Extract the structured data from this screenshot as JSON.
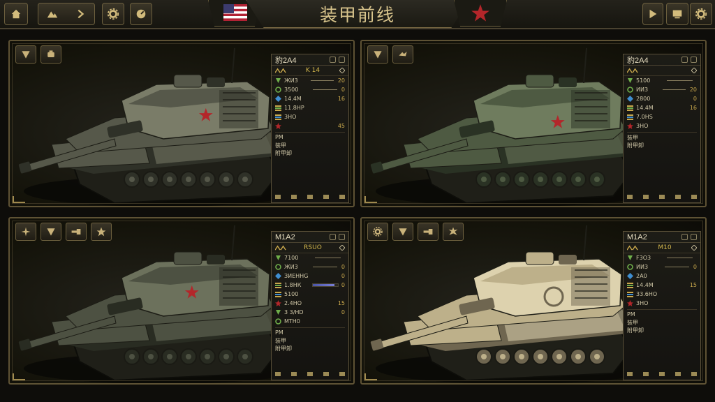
{
  "header": {
    "title": "装甲前线",
    "nations": [
      "us-flag-icon",
      "red-star-icon"
    ],
    "left_buttons": [
      "home-icon",
      "hills-icon",
      "chevron-right-icon",
      "gear-icon",
      "gauge-icon"
    ],
    "right_buttons": [
      "play-icon",
      "monitor-icon",
      "gear-icon"
    ]
  },
  "colors": {
    "accent": "#c9a84c",
    "border": "#5e5234",
    "red_star": "#b3262a",
    "bar": "#5a64c0"
  },
  "panels": [
    {
      "name": "豹2A4",
      "class_label": "K 14",
      "rows": [
        {
          "label": "ЖИ3",
          "value": "20"
        },
        {
          "label": "3500",
          "value": "0"
        },
        {
          "label": "14.4M",
          "value": "16"
        },
        {
          "label": "11.8НР",
          "value": ""
        },
        {
          "label": "3HO",
          "value": ""
        },
        {
          "label": "",
          "value": "45"
        }
      ],
      "foot_labels": [
        "PM",
        "装甲",
        "附甲卸"
      ],
      "tools": [
        "armor-icon",
        "engine-icon"
      ]
    },
    {
      "name": "豹2A4",
      "class_label": "",
      "rows": [
        {
          "label": "5100",
          "value": ""
        },
        {
          "label": "ИИ3",
          "value": "20"
        },
        {
          "label": "2800",
          "value": "0"
        },
        {
          "label": "14.4M",
          "value": "16"
        },
        {
          "label": "7.0HS",
          "value": ""
        },
        {
          "label": "3HO",
          "value": ""
        }
      ],
      "foot_labels": [
        "装甲",
        "附甲卸"
      ],
      "tools": [
        "armor-icon",
        "track-icon"
      ]
    },
    {
      "name": "M1A2",
      "class_label": "RSUO",
      "rows": [
        {
          "label": "7100",
          "value": ""
        },
        {
          "label": "ЖИ3",
          "value": "0"
        },
        {
          "label": "ЗИЕННG",
          "value": "0"
        },
        {
          "label": "1.8НК",
          "value": "0",
          "bar": 0.85
        },
        {
          "label": "5100",
          "value": ""
        },
        {
          "label": "2.4HO",
          "value": "15"
        },
        {
          "label": "3 3/HD",
          "value": "0"
        },
        {
          "label": "MTH0",
          "value": ""
        }
      ],
      "foot_labels": [
        "PM",
        "装甲",
        "附甲卸"
      ],
      "tools": [
        "compass-icon",
        "armor-icon",
        "cannon-icon",
        "star-icon"
      ]
    },
    {
      "name": "M1A2",
      "class_label": "M10",
      "rows": [
        {
          "label": "F3O3",
          "value": ""
        },
        {
          "label": "ИИ3",
          "value": "0"
        },
        {
          "label": "2A0",
          "value": ""
        },
        {
          "label": "14.4M",
          "value": "15"
        },
        {
          "label": "33.6HO",
          "value": ""
        },
        {
          "label": "3HO",
          "value": ""
        }
      ],
      "foot_labels": [
        "PM",
        "装甲",
        "附甲卸"
      ],
      "tools": [
        "gear-icon",
        "armor-icon",
        "cannon-icon",
        "splash-icon"
      ]
    }
  ]
}
